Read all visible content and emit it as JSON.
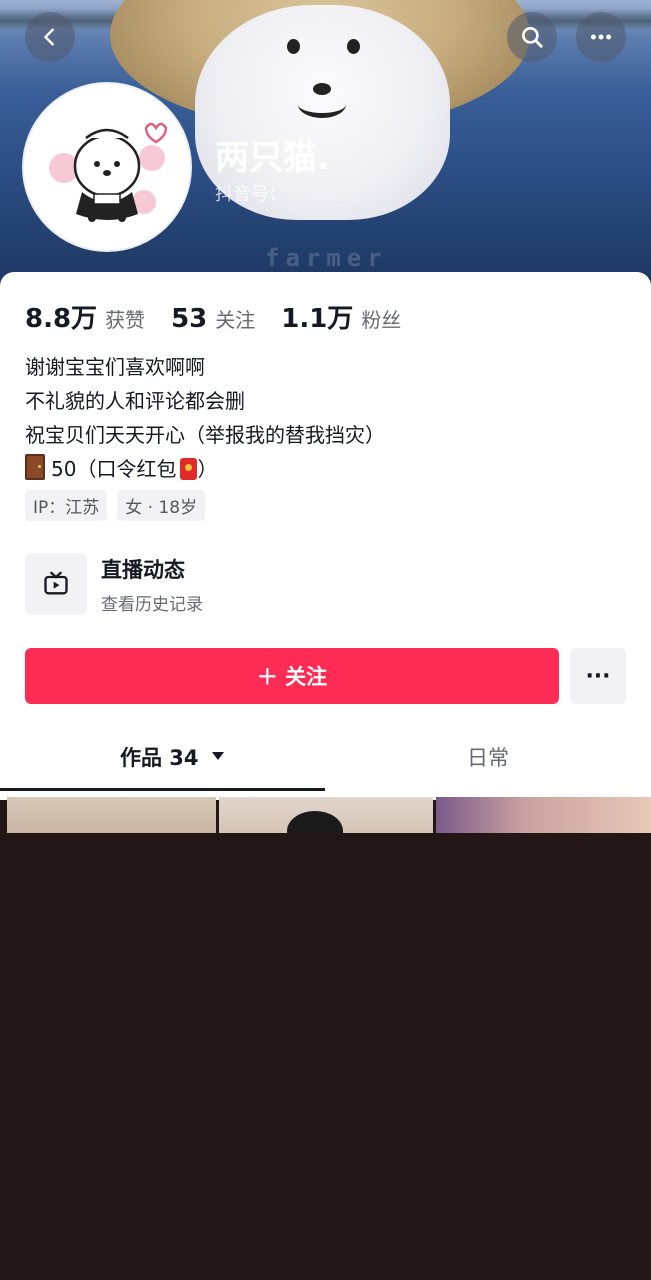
{
  "profile": {
    "name": "两只猫.",
    "douyin_id_label": "抖音号：",
    "banner_watermark": "farmer"
  },
  "stats": [
    {
      "value": "8.8万",
      "label": "获赞"
    },
    {
      "value": "53",
      "label": "关注"
    },
    {
      "value": "1.1万",
      "label": "粉丝"
    }
  ],
  "bio": {
    "line1": "谢谢宝宝们喜欢啊啊",
    "line2": "不礼貌的人和评论都会删",
    "line3": "祝宝贝们天天开心（举报我的替我挡灾）",
    "line4_text": "50（口令红包",
    "line4_end": "）"
  },
  "tags": {
    "ip": "IP：江苏",
    "gender_age": "女 · 18岁"
  },
  "live": {
    "title": "直播动态",
    "subtitle": "查看历史记录",
    "icon": "tv-icon"
  },
  "actions": {
    "follow_label": "＋ 关注",
    "more_label": "···"
  },
  "tabs": {
    "works_label": "作品 34",
    "daily_label": "日常"
  },
  "icons": {
    "back": "chevron-left-icon",
    "search": "search-icon",
    "more": "more-dots-icon"
  },
  "colors": {
    "accent": "#fe2c55",
    "text_primary": "#161823",
    "text_secondary": "#686a73"
  }
}
